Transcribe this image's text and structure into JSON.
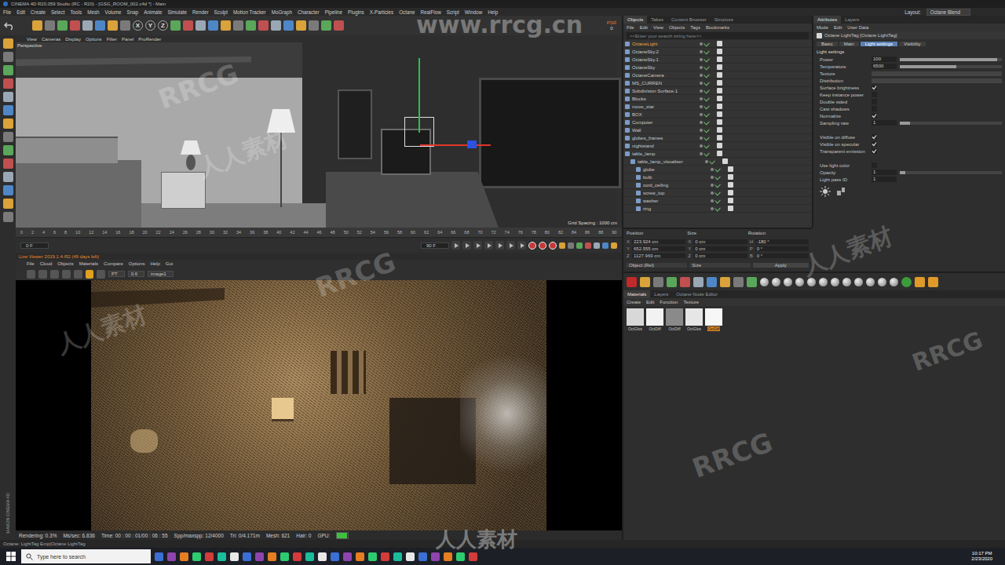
{
  "window": {
    "title": "CINEMA 4D R20.059 Studio (RC - R20) - [GSG_ROOM_002.c4d *] - Main"
  },
  "menu": [
    "File",
    "Edit",
    "Create",
    "Select",
    "Tools",
    "Mesh",
    "Volume",
    "Snap",
    "Animate",
    "Simulate",
    "Render",
    "Sculpt",
    "Motion Tracker",
    "MoGraph",
    "Character",
    "Pipeline",
    "Plugins",
    "X-Particles",
    "Octane",
    "RealFlow",
    "Script",
    "Window",
    "Help"
  ],
  "layout": {
    "label": "Layout:",
    "value": "Octane Blend"
  },
  "toolbar": {
    "axis_buttons": [
      "X",
      "Y",
      "Z"
    ],
    "badge": "PSR",
    "badge_value": "0"
  },
  "viewport": {
    "menu": [
      "View",
      "Cameras",
      "Display",
      "Options",
      "Filter",
      "Panel",
      "ProRender"
    ],
    "label": "Perspective",
    "grid": "Grid Spacing : 1000 cm"
  },
  "timeline": {
    "ticks": [
      "0",
      "2",
      "4",
      "6",
      "8",
      "10",
      "12",
      "14",
      "16",
      "18",
      "20",
      "22",
      "24",
      "26",
      "28",
      "30",
      "32",
      "34",
      "36",
      "38",
      "40",
      "42",
      "44",
      "46",
      "48",
      "50",
      "52",
      "54",
      "56",
      "58",
      "60",
      "62",
      "64",
      "66",
      "68",
      "70",
      "72",
      "74",
      "76",
      "78",
      "80",
      "82",
      "84",
      "86",
      "88",
      "90"
    ],
    "start": "0 F",
    "end": "90 F"
  },
  "live_viewer": {
    "title": "Live Viewer 2019.1.4-R2 (49 days left)",
    "menu": [
      "File",
      "Cloud",
      "Objects",
      "Materials",
      "Compare",
      "Options",
      "Help",
      "Gui"
    ],
    "controls": [
      "PT",
      "0.6",
      "image1"
    ],
    "status": [
      {
        "label": "Rendering:",
        "value": "0.3%"
      },
      {
        "label": "Ms/sec:",
        "value": "6.836"
      },
      {
        "label": "Time:",
        "value": "00 : 00 : 01/00 : 06 : 55"
      },
      {
        "label": "Spp/maxspp:",
        "value": "12/4000"
      },
      {
        "label": "Tri:",
        "value": "0/4.171m"
      },
      {
        "label": "Mesh:",
        "value": "621"
      },
      {
        "label": "Hair:",
        "value": "0"
      }
    ],
    "gpu": {
      "label": "GPU:",
      "level": 0.9
    }
  },
  "brand": "MAXON CINEMA 4D",
  "objects": {
    "tabs": [
      {
        "label": "Objects",
        "selected": true
      },
      {
        "label": "Takes",
        "selected": false
      },
      {
        "label": "Content Browser",
        "selected": false
      },
      {
        "label": "Structure",
        "selected": false
      }
    ],
    "menu": [
      "File",
      "Edit",
      "View",
      "Objects",
      "Tags",
      "Bookmarks"
    ],
    "search": {
      "placeholder": "<<Enter your search string here>>"
    },
    "items": [
      {
        "name": "OctaneLight",
        "depth": 0,
        "selected": true
      },
      {
        "name": "OctaneSky.2",
        "depth": 0,
        "selected": false
      },
      {
        "name": "OctaneSky.1",
        "depth": 0,
        "selected": false
      },
      {
        "name": "OctaneSky",
        "depth": 0,
        "selected": false
      },
      {
        "name": "OctaneCamera",
        "depth": 0,
        "selected": false
      },
      {
        "name": "MS_CURREN",
        "depth": 0,
        "selected": false
      },
      {
        "name": "Subdivision Surface.1",
        "depth": 0,
        "selected": false
      },
      {
        "name": "Blocks",
        "depth": 0,
        "selected": false
      },
      {
        "name": "move_star",
        "depth": 0,
        "selected": false
      },
      {
        "name": "BOX",
        "depth": 0,
        "selected": false
      },
      {
        "name": "Computer",
        "depth": 0,
        "selected": false
      },
      {
        "name": "Wall",
        "depth": 0,
        "selected": false
      },
      {
        "name": "globes_frames",
        "depth": 0,
        "selected": false
      },
      {
        "name": "nightstand",
        "depth": 0,
        "selected": false
      },
      {
        "name": "table_lamp",
        "depth": 0,
        "selected": false
      },
      {
        "name": "table_lamp_visualiser",
        "depth": 1,
        "selected": false
      },
      {
        "name": "globe",
        "depth": 2,
        "selected": false
      },
      {
        "name": "bulb",
        "depth": 2,
        "selected": false
      },
      {
        "name": "cord_ceiling",
        "depth": 2,
        "selected": false
      },
      {
        "name": "screw_top",
        "depth": 2,
        "selected": false
      },
      {
        "name": "washer",
        "depth": 2,
        "selected": false
      },
      {
        "name": "ring",
        "depth": 2,
        "selected": false
      }
    ]
  },
  "coordinates": {
    "headers": [
      "Position",
      "Size",
      "Rotation"
    ],
    "rows": [
      {
        "axis": "X",
        "position": "223.924 cm",
        "size": "0 cm",
        "rot_axis": "H",
        "rotation": "-180 °"
      },
      {
        "axis": "Y",
        "position": "652.555 cm",
        "size": "0 cm",
        "rot_axis": "P",
        "rotation": "0 °"
      },
      {
        "axis": "Z",
        "position": "1127.969 cm",
        "size": "0 cm",
        "rot_axis": "B",
        "rotation": "0 °"
      }
    ],
    "mode": "Object (Rel)",
    "size_mode": "Size",
    "apply": "Apply"
  },
  "materials": {
    "tabs": [
      {
        "label": "Materials",
        "selected": true
      },
      {
        "label": "Layers",
        "selected": false
      },
      {
        "label": "Octane Node Editor",
        "selected": false
      }
    ],
    "menu": [
      "Create",
      "Edit",
      "Function",
      "Texture"
    ],
    "items": [
      {
        "name": "OctGlos",
        "selected": false,
        "color": "#d8d8d8"
      },
      {
        "name": "OctDiff",
        "selected": false,
        "color": "#f2f2f2"
      },
      {
        "name": "OctDiff",
        "selected": false,
        "color": "#8a8a8a"
      },
      {
        "name": "OctGlos",
        "selected": false,
        "color": "#e6e6e6"
      },
      {
        "name": "OctDiff",
        "selected": true,
        "color": "#f7f7f7"
      }
    ]
  },
  "attributes": {
    "tabs": [
      {
        "label": "Attributes",
        "selected": true
      },
      {
        "label": "Layers",
        "selected": false
      }
    ],
    "menu": [
      "Mode",
      "Edit",
      "User Data"
    ],
    "title": "Octane LightTag [Octane LightTag]",
    "subtabs": [
      {
        "label": "Basic",
        "selected": false
      },
      {
        "label": "Main",
        "selected": false
      },
      {
        "label": "Light settings",
        "selected": true
      },
      {
        "label": "Visibility",
        "selected": false
      }
    ],
    "section": "Light settings",
    "rows": [
      {
        "kind": "slider",
        "label": "Power",
        "value": "100",
        "level": 0.95
      },
      {
        "kind": "slider",
        "label": "Temperature",
        "value": "6500",
        "level": 0.55
      },
      {
        "kind": "field",
        "label": "Texture"
      },
      {
        "kind": "field",
        "label": "Distribution"
      },
      {
        "kind": "check",
        "label": "Surface brightness",
        "checked": true
      },
      {
        "kind": "check",
        "label": "Keep instance power",
        "checked": false
      },
      {
        "kind": "check",
        "label": "Double sided",
        "checked": false
      },
      {
        "kind": "check",
        "label": "Cast shadows",
        "checked": false
      },
      {
        "kind": "check",
        "label": "Normalize",
        "checked": true
      },
      {
        "kind": "slider",
        "label": "Sampling rate",
        "value": "1",
        "level": 0.1
      },
      {
        "kind": "spacer"
      },
      {
        "kind": "check",
        "label": "Visible on diffuse",
        "checked": true
      },
      {
        "kind": "check",
        "label": "Visible on specular",
        "checked": true
      },
      {
        "kind": "check",
        "label": "Transparent emission",
        "checked": true
      },
      {
        "kind": "spacer"
      },
      {
        "kind": "check",
        "label": "Use light color",
        "checked": false
      },
      {
        "kind": "slider",
        "label": "Opacity",
        "value": "1",
        "level": 0.05
      },
      {
        "kind": "number",
        "label": "Light pass ID",
        "value": "1"
      }
    ]
  },
  "status_line": "Octane: LightTag Emp|Octane LightTag",
  "taskbar": {
    "search_placeholder": "Type here to search",
    "time": "10:17 PM",
    "date": "2/23/2020"
  },
  "watermarks": [
    {
      "text": "www.rrcg.cn"
    },
    {
      "text": "RRCG"
    },
    {
      "text": "RRCG"
    },
    {
      "text": "RRCG"
    },
    {
      "text": "RRCG"
    },
    {
      "text": "人人素材"
    },
    {
      "text": "人人素材"
    },
    {
      "text": "人人素材"
    },
    {
      "text": "人人素材"
    }
  ]
}
